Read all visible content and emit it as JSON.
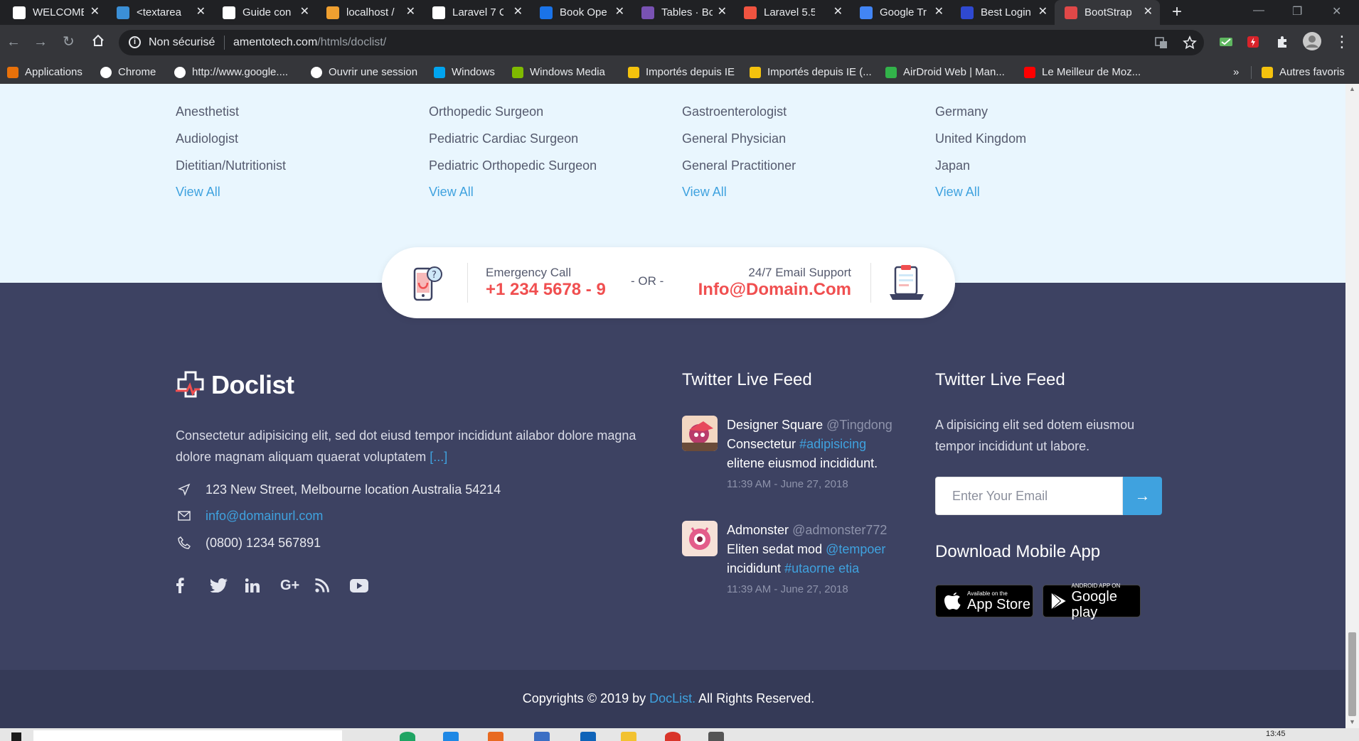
{
  "browser": {
    "tabs": [
      {
        "label": "WELCOME",
        "icon": "wordpress-icon",
        "color": "#ffffff"
      },
      {
        "label": "<textarea",
        "icon": "puzzle-icon",
        "color": "#3b8fd6"
      },
      {
        "label": "Guide con",
        "icon": "medium-icon",
        "color": "#ffffff"
      },
      {
        "label": "localhost /",
        "icon": "phpmyadmin-icon",
        "color": "#f0a030"
      },
      {
        "label": "Laravel 7 C",
        "icon": "medium-icon",
        "color": "#ffffff"
      },
      {
        "label": "Book Ope",
        "icon": "flag-icon",
        "color": "#1a73e8"
      },
      {
        "label": "Tables · Bo",
        "icon": "bootstrap-icon",
        "color": "#7952b3"
      },
      {
        "label": "Laravel 5.5",
        "icon": "laravel-icon",
        "color": "#f05340"
      },
      {
        "label": "Google Tr",
        "icon": "translate-icon",
        "color": "#4285f4"
      },
      {
        "label": "Best Login",
        "icon": "bootstrap-b-icon",
        "color": "#2f49d1"
      },
      {
        "label": "BootStrap",
        "icon": "site-icon",
        "color": "#e04848"
      }
    ],
    "security": "Non sécurisé",
    "url_host": "amentotech.com",
    "url_path": "/htmls/doclist/",
    "bookmarks": [
      {
        "label": "Applications",
        "icon": "apps-icon",
        "color": "#e8710a"
      },
      {
        "label": "Chrome",
        "icon": "google-icon",
        "color": "#ffffff"
      },
      {
        "label": "http://www.google....",
        "icon": "google-icon",
        "color": "#ffffff"
      },
      {
        "label": "Ouvrir une session",
        "icon": "globe-icon",
        "color": "#ffffff"
      },
      {
        "label": "Windows",
        "icon": "windows-icon",
        "color": "#00a4ef"
      },
      {
        "label": "Windows Media",
        "icon": "windows-icon",
        "color": "#7fba00"
      },
      {
        "label": "Importés depuis IE",
        "icon": "folder-icon",
        "color": "#f4c20d"
      },
      {
        "label": "Importés depuis IE (...",
        "icon": "folder-icon",
        "color": "#f4c20d"
      },
      {
        "label": "AirDroid Web | Man...",
        "icon": "airdroid-icon",
        "color": "#32b34a"
      },
      {
        "label": "Le Meilleur de Moz...",
        "icon": "youtube-icon",
        "color": "#ff0000"
      }
    ],
    "bookmarks_more": "»",
    "other_bookmarks": "Autres favoris"
  },
  "listing": {
    "columns": [
      {
        "items": [
          "Anesthetist",
          "Audiologist",
          "Dietitian/Nutritionist"
        ],
        "view_all": "View All"
      },
      {
        "items": [
          "Orthopedic Surgeon",
          "Pediatric Cardiac Surgeon",
          "Pediatric Orthopedic Surgeon"
        ],
        "view_all": "View All"
      },
      {
        "items": [
          "Gastroenterologist",
          "General Physician",
          "General Practitioner"
        ],
        "view_all": "View All"
      },
      {
        "items": [
          "Germany",
          "United Kingdom",
          "Japan"
        ],
        "view_all": "View All"
      }
    ]
  },
  "callbar": {
    "emergency_label": "Emergency Call",
    "emergency_phone": "+1 234 5678 - 9",
    "or_text": "- OR -",
    "email_label": "24/7 Email Support",
    "email_value": "Info@Domain.Com"
  },
  "footer": {
    "logo_text": "Doclist",
    "about": "Consectetur adipisicing elit, sed dot eiusd tempor incididunt ailabor dolore magna dolore magnam aliquam quaerat voluptatem",
    "about_more": "[...]",
    "address": "123 New Street, Melbourne location Australia 54214",
    "email": "info@domainurl.com",
    "phone": "(0800) 1234 567891",
    "social": [
      "facebook-icon",
      "twitter-icon",
      "linkedin-icon",
      "google-plus-icon",
      "rss-icon",
      "youtube-icon"
    ],
    "twitter_title": "Twitter Live Feed",
    "tweets": [
      {
        "name": "Designer Square",
        "handle": "@Tingdong",
        "text": "Consectetur",
        "hashtag": "#adipisicing",
        "text2": "elitene eiusmod incididunt.",
        "time": "11:39 AM - June 27, 2018"
      },
      {
        "name": "Admonster",
        "handle": "@admonster772",
        "text": "Eliten sedat mod",
        "hashtag": "@tempoer",
        "text2": "incididunt",
        "hashtag2": "#utaorne etia",
        "time": "11:39 AM - June 27, 2018"
      }
    ],
    "newsletter_title": "Twitter Live Feed",
    "newsletter_text": "A dipisicing elit sed dotem eiusmou tempor incididunt ut labore.",
    "email_placeholder": "Enter Your Email",
    "download_title": "Download Mobile App",
    "app_store_small": "Available on the",
    "app_store_big": "App Store",
    "google_play_small": "ANDROID APP ON",
    "google_play_big": "Google play",
    "copyright_prefix": "Copyrights © 2019 by",
    "copyright_brand": "DocList.",
    "copyright_suffix": "All Rights Reserved."
  },
  "taskbar": {
    "time": "13:45"
  },
  "colors": {
    "accent": "#3fa2df",
    "emergency_red": "#f04f50",
    "footer_bg": "#3d4262",
    "light_bg": "#e9f6fe"
  }
}
